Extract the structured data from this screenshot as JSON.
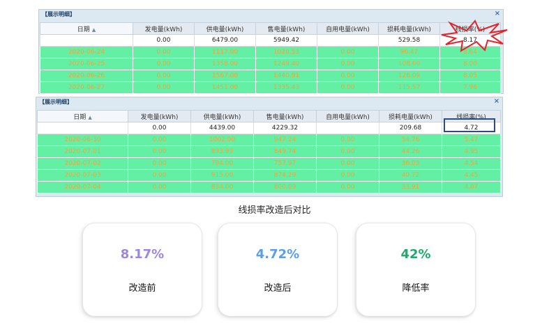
{
  "panel_title": "【展示明细】",
  "close_glyph": "×",
  "sort_glyph": "▲",
  "columns": [
    "日期",
    "发电量(kWh)",
    "供电量(kWh)",
    "售电量(kWh)",
    "自用电量(kWh)",
    "损耗电量(kWh)",
    "线损率(%)"
  ],
  "before": {
    "summary": [
      "",
      "0.00",
      "6479.00",
      "5949.42",
      "",
      "529.58",
      "8.17"
    ],
    "rows": [
      [
        "2020-06-24",
        "0.00",
        "1117.00",
        "1020.53",
        "0.00",
        "96.47",
        "8.64"
      ],
      [
        "2020-06-25",
        "0.00",
        "1358.00",
        "1249.40",
        "0.00",
        "108.60",
        "8.00"
      ],
      [
        "2020-06-26",
        "0.00",
        "1567.00",
        "1440.91",
        "0.00",
        "126.09",
        "8.05"
      ],
      [
        "2020-06-27",
        "0.00",
        "1451.00",
        "1335.43",
        "0.00",
        "115.57",
        "7.96"
      ]
    ]
  },
  "after": {
    "summary": [
      "",
      "0.00",
      "4439.00",
      "4229.32",
      "",
      "209.68",
      "4.72"
    ],
    "rows": [
      [
        "2020-06-30",
        "0.00",
        "1002.00",
        "947.24",
        "0.00",
        "54.76",
        "5.47"
      ],
      [
        "2020-07-01",
        "0.00",
        "893.99",
        "849.74",
        "0.00",
        "44.26",
        "4.95"
      ],
      [
        "2020-07-02",
        "0.00",
        "794.00",
        "757.97",
        "0.00",
        "36.03",
        "4.54"
      ],
      [
        "2020-07-03",
        "0.00",
        "915.00",
        "874.29",
        "0.00",
        "40.72",
        "4.45"
      ],
      [
        "2020-07-04",
        "0.00",
        "834.00",
        "800.09",
        "0.00",
        "33.91",
        "4.07"
      ]
    ]
  },
  "caption": "线损率改造后对比",
  "cards": [
    {
      "value": "8.17%",
      "label": "改造前",
      "color": "#9b86e0"
    },
    {
      "value": "4.72%",
      "label": "改造后",
      "color": "#5b9ee6"
    },
    {
      "value": "42%",
      "label": "降低率",
      "color": "#1fa971"
    }
  ],
  "colors": {
    "row_bg": "#63f0a5",
    "row_text": "#f7a13a",
    "header_bg": "#e3eaf1",
    "burst_stroke": "#e0242a",
    "highlight_box": "#2a4b8a"
  }
}
